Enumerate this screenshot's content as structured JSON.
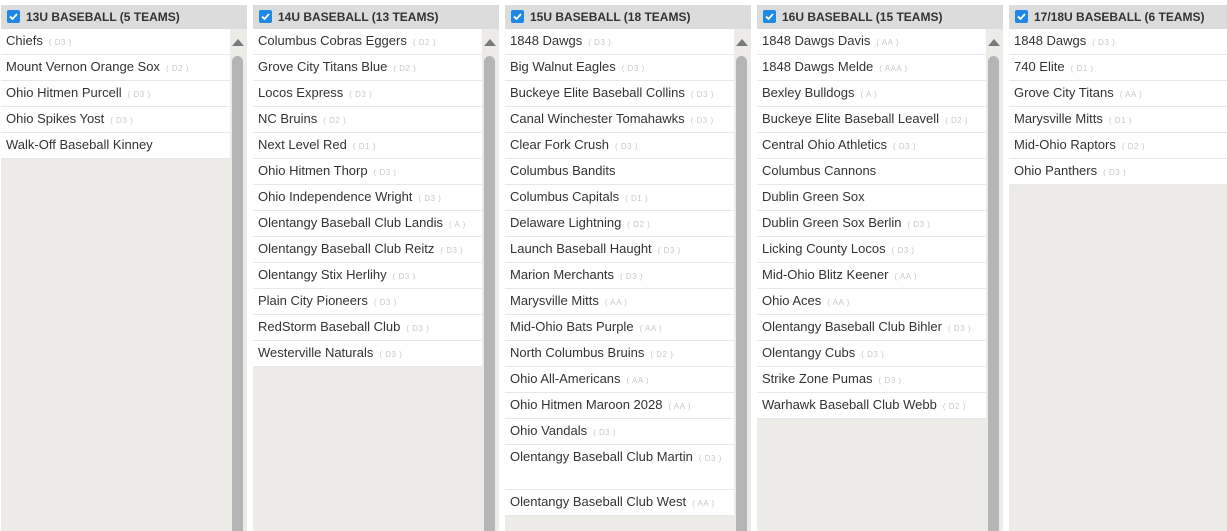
{
  "columns": [
    {
      "title": "13U BASEBALL (5 TEAMS)",
      "teams": [
        {
          "name": "Chiefs",
          "division": "( D3 )"
        },
        {
          "name": "Mount Vernon Orange Sox",
          "division": "( D2 )"
        },
        {
          "name": "Ohio Hitmen Purcell",
          "division": "( D3 )"
        },
        {
          "name": "Ohio Spikes Yost",
          "division": "( D3 )"
        },
        {
          "name": "Walk-Off Baseball Kinney",
          "division": ""
        }
      ]
    },
    {
      "title": "14U BASEBALL (13 TEAMS)",
      "teams": [
        {
          "name": "Columbus Cobras Eggers",
          "division": "( D2 )"
        },
        {
          "name": "Grove City Titans Blue",
          "division": "( D2 )"
        },
        {
          "name": "Locos Express",
          "division": "( D3 )"
        },
        {
          "name": "NC Bruins",
          "division": "( D2 )"
        },
        {
          "name": "Next Level Red",
          "division": "( D1 )"
        },
        {
          "name": "Ohio Hitmen Thorp",
          "division": "( D3 )"
        },
        {
          "name": "Ohio Independence Wright",
          "division": "( D3 )"
        },
        {
          "name": "Olentangy Baseball Club Landis",
          "division": "( A )"
        },
        {
          "name": "Olentangy Baseball Club Reitz",
          "division": "( D3 )"
        },
        {
          "name": "Olentangy Stix Herlihy",
          "division": "( D3 )"
        },
        {
          "name": "Plain City Pioneers",
          "division": "( D3 )"
        },
        {
          "name": "RedStorm Baseball Club",
          "division": "( D3 )"
        },
        {
          "name": "Westerville Naturals",
          "division": "( D3 )"
        }
      ]
    },
    {
      "title": "15U BASEBALL (18 TEAMS)",
      "teams": [
        {
          "name": "1848 Dawgs",
          "division": "( D3 )"
        },
        {
          "name": "Big Walnut Eagles",
          "division": "( D3 )"
        },
        {
          "name": "Buckeye Elite Baseball Collins",
          "division": "( D3 )"
        },
        {
          "name": "Canal Winchester Tomahawks",
          "division": "( D3 )"
        },
        {
          "name": "Clear Fork Crush",
          "division": "( D3 )"
        },
        {
          "name": "Columbus Bandits",
          "division": ""
        },
        {
          "name": "Columbus Capitals",
          "division": "( D1 )"
        },
        {
          "name": "Delaware Lightning",
          "division": "( D2 )"
        },
        {
          "name": "Launch Baseball Haught",
          "division": "( D3 )"
        },
        {
          "name": "Marion Merchants",
          "division": "( D3 )"
        },
        {
          "name": "Marysville Mitts",
          "division": "( AA )"
        },
        {
          "name": "Mid-Ohio Bats Purple",
          "division": "( AA )"
        },
        {
          "name": "North Columbus Bruins",
          "division": "( D2 )"
        },
        {
          "name": "Ohio All-Americans",
          "division": "( AA )"
        },
        {
          "name": "Ohio Hitmen Maroon 2028",
          "division": "( AA )"
        },
        {
          "name": "Ohio Vandals",
          "division": "( D3 )"
        },
        {
          "name": "Olentangy Baseball Club Martin",
          "division": "( D3 )"
        },
        {
          "name": "Olentangy Baseball Club West",
          "division": "( AA )"
        }
      ]
    },
    {
      "title": "16U BASEBALL (15 TEAMS)",
      "teams": [
        {
          "name": "1848 Dawgs Davis",
          "division": "( AA )"
        },
        {
          "name": "1848 Dawgs Melde",
          "division": "( AAA )"
        },
        {
          "name": "Bexley Bulldogs",
          "division": "( A )"
        },
        {
          "name": "Buckeye Elite Baseball Leavell",
          "division": "( D2 )"
        },
        {
          "name": "Central Ohio Athletics",
          "division": "( D3 )"
        },
        {
          "name": "Columbus Cannons",
          "division": ""
        },
        {
          "name": "Dublin Green Sox",
          "division": ""
        },
        {
          "name": "Dublin Green Sox Berlin",
          "division": "( D3 )"
        },
        {
          "name": "Licking County Locos",
          "division": "( D3 )"
        },
        {
          "name": "Mid-Ohio Blitz Keener",
          "division": "( AA )"
        },
        {
          "name": "Ohio Aces",
          "division": "( AA )"
        },
        {
          "name": "Olentangy Baseball Club Bihler",
          "division": "( D3 )"
        },
        {
          "name": "Olentangy Cubs",
          "division": "( D3 )"
        },
        {
          "name": "Strike Zone Pumas",
          "division": "( D3 )"
        },
        {
          "name": "Warhawk Baseball Club Webb",
          "division": "( D2 )"
        }
      ]
    },
    {
      "title": "17/18U BASEBALL (6 TEAMS)",
      "teams": [
        {
          "name": "1848 Dawgs",
          "division": "( D3 )"
        },
        {
          "name": "740 Elite",
          "division": "( D1 )"
        },
        {
          "name": "Grove City Titans",
          "division": "( AA )"
        },
        {
          "name": "Marysville Mitts",
          "division": "( D1 )"
        },
        {
          "name": "Mid-Ohio Raptors",
          "division": "( D2 )"
        },
        {
          "name": "Ohio Panthers",
          "division": "( D3 )"
        }
      ]
    }
  ],
  "colors": {
    "checkbox": "#1e88e5",
    "header_bg": "#dcdcdc",
    "column_bg": "#ecebe8",
    "scroll_thumb": "#b5b5b5"
  }
}
